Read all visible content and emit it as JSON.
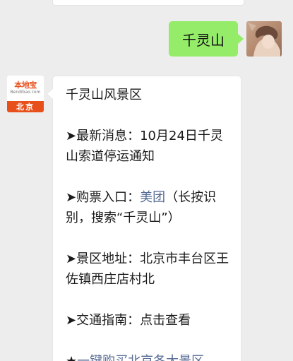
{
  "outgoing": {
    "text": "千灵山"
  },
  "incoming": {
    "avatar": {
      "logo_text": "本地宝",
      "url_text": "Bendibao.com",
      "city": "北京"
    },
    "title": "千灵山风景区",
    "latest": {
      "prefix": "➤最新消息：",
      "text": "10月24日千灵山索道停运通知"
    },
    "ticket": {
      "prefix": "➤购票入口：",
      "link": "美团",
      "suffix": "（长按识别，搜索“千灵山”）"
    },
    "address": {
      "prefix": "➤景区地址：",
      "text": "北京市丰台区王佐镇西庄店村北"
    },
    "traffic": {
      "prefix": "➤交通指南：",
      "text": "点击查看"
    },
    "buy_all": {
      "prefix": "★",
      "link": "一键购买北京各大景区"
    }
  },
  "colors": {
    "chat_background": "#ededed",
    "outgoing_bubble": "#95ec69",
    "link": "#576b95",
    "brand": "#e8501b"
  }
}
